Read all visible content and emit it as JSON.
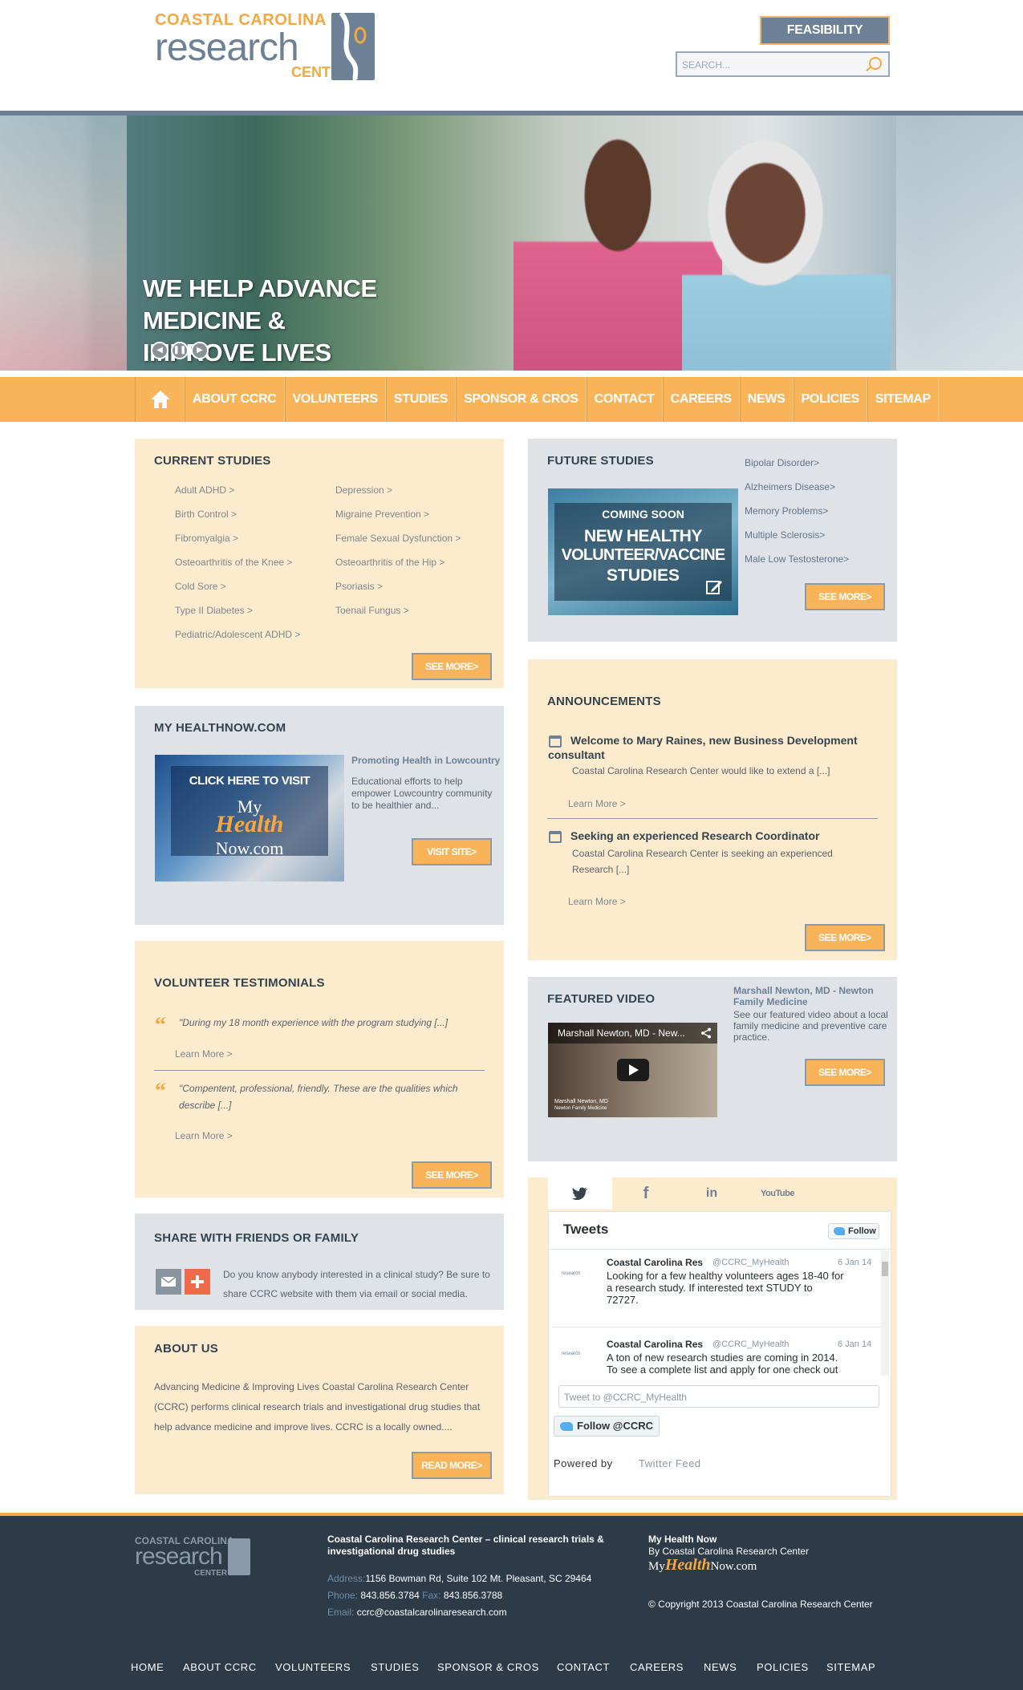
{
  "header": {
    "logo": {
      "line1": "COASTAL CAROLINA",
      "line2": "research",
      "line3": "CENTER"
    },
    "feasibility_label": "FEASIBILITY REQUESTS",
    "search_placeholder": "SEARCH..."
  },
  "hero": {
    "title_line1": "WE HELP ADVANCE MEDICINE &",
    "title_line2": "IMPROVE LIVES"
  },
  "nav": {
    "items": [
      "ABOUT CCRC",
      "VOLUNTEERS",
      "STUDIES",
      "SPONSOR & CROS",
      "CONTACT",
      "CAREERS",
      "NEWS",
      "POLICIES",
      "SITEMAP"
    ]
  },
  "current_studies": {
    "title": "CURRENT STUDIES",
    "left": [
      "Adult ADHD >",
      "Birth Control >",
      "Fibromyalgia >",
      "Osteoarthritis of the Knee >",
      "Cold Sore >",
      "Type II Diabetes >",
      "Pediatric/Adolescent ADHD >"
    ],
    "right": [
      "Depression >",
      "Migraine Prevention >",
      "Female Sexual Dysfunction >",
      "Osteoarthritis of the Hip >",
      "Psoriasis >",
      "Toenail Fungus >"
    ],
    "button": "SEE MORE>"
  },
  "future_studies": {
    "title": "FUTURE STUDIES",
    "image_text": {
      "l1": "COMING SOON",
      "l2": "NEW HEALTHY",
      "l3": "VOLUNTEER/VACCINE",
      "l4": "STUDIES"
    },
    "links": [
      "Bipolar Disorder>",
      "Alzheimers Disease>",
      "Memory Problems>",
      "Multiple Sclerosis>",
      "Male Low Testosterone>"
    ],
    "button": "SEE MORE>"
  },
  "myhealth": {
    "title": "MY HEALTHNOW.COM",
    "image_text": {
      "l1": "CLICK HERE TO VISIT",
      "l2": "My",
      "l3": "Health",
      "l4": "Now.com"
    },
    "link_title": "Promoting Health in Lowcountry",
    "body": "Educational efforts to help empower Lowcountry community to be healthier and...",
    "button": "VISIT SITE>"
  },
  "announcements": {
    "title": "ANNOUNCEMENTS",
    "items": [
      {
        "title": "Welcome to Mary Raines, new Business Development consultant",
        "body": "Coastal Carolina Research Center would like to extend a [...]",
        "more": "Learn More >"
      },
      {
        "title": "Seeking an experienced Research Coordinator",
        "body": "Coastal Carolina Research Center is seeking an experienced Research [...]",
        "more": "Learn More >"
      }
    ],
    "button": "SEE MORE>"
  },
  "testimonials": {
    "title": "VOLUNTEER TESTIMONIALS",
    "items": [
      {
        "quote": "\"During my 18 month experience with the program studying [...]",
        "more": "Learn More >"
      },
      {
        "quote": "\"Compentent, professional, friendly. These are the qualities which describe [...]",
        "more": "Learn More >"
      }
    ],
    "button": "SEE MORE>"
  },
  "featured_video": {
    "title": "FEATURED VIDEO",
    "video_title": "Marshall Newton, MD - New...",
    "caption_name": "Marshall Newton, MD",
    "caption_org": "Newton Family Medicine",
    "link_title": "Marshall Newton, MD - Newton Family Medicine",
    "body": "See our featured video about a local family medicine and preventive care practice.",
    "button": "SEE MORE>"
  },
  "share": {
    "title": "SHARE WITH FRIENDS OR FAMILY",
    "body": "Do you know anybody interested in a clinical study? Be sure to share CCRC website with them via email or social media."
  },
  "about": {
    "title": "ABOUT US",
    "body": "Advancing Medicine & Improving Lives Coastal Carolina Research Center (CCRC) performs clinical research trials and investigational drug studies that help advance medicine and improve lives. CCRC is a locally owned....",
    "button": "READ MORE>"
  },
  "twitter": {
    "tabs": [
      "twitter",
      "f",
      "in",
      "YouTube"
    ],
    "heading": "Tweets",
    "follow": "Follow",
    "tweets": [
      {
        "name": "Coastal Carolina Res",
        "handle": "@CCRC_MyHealth",
        "date": "6 Jan 14",
        "text": "Looking for a few healthy volunteers ages 18-40  for a research study. If interested text STUDY to 72727."
      },
      {
        "name": "Coastal Carolina Res",
        "handle": "@CCRC_MyHealth",
        "date": "6 Jan 14",
        "text": "A ton of new research studies are coming in 2014. To see a complete list and apply for one check out"
      }
    ],
    "compose_placeholder": "Tweet to @CCRC_MyHealth",
    "follow_btn": "Follow @CCRC",
    "powered_by": "Powered by",
    "powered_link": "Twitter Feed"
  },
  "footer": {
    "logo": {
      "line1": "COASTAL CAROLINA",
      "line2": "research",
      "line3": "CENTER"
    },
    "col1_title": "Coastal Carolina Research Center – clinical research trials & investigational drug studies",
    "address_label": "Address:",
    "address": "1156 Bowman Rd, Suite 102 Mt. Pleasant, SC 29464",
    "phone_label": "Phone:",
    "phone": "843.856.3784",
    "fax_label": "Fax:",
    "fax": "843.856.3788",
    "email_label": "Email:",
    "email": "ccrc@coastalcarolinaresearch.com",
    "col2_title1": "My Health Now",
    "col2_title2": "By Coastal Carolina Research Center",
    "mh_logo": {
      "a": "My",
      "b": "Health",
      "c": "Now.com"
    },
    "copyright": "© Copyright 2013 Coastal Carolina Research Center",
    "nav": [
      "HOME",
      "ABOUT CCRC",
      "VOLUNTEERS",
      "STUDIES",
      "SPONSOR & CROS",
      "CONTACT",
      "CAREERS",
      "NEWS",
      "POLICIES",
      "SITEMAP"
    ]
  }
}
